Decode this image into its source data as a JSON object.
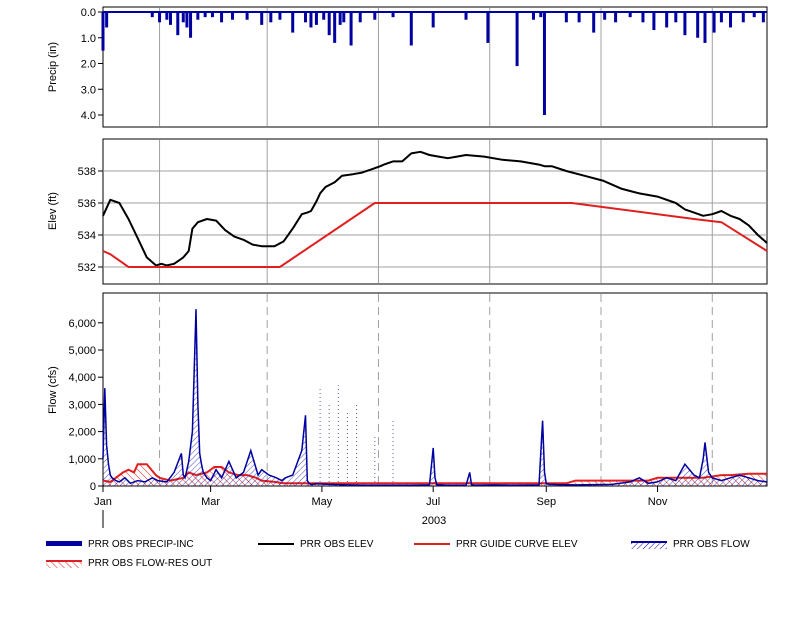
{
  "year_label": "2003",
  "x_months": [
    "Jan",
    "Mar",
    "May",
    "Jul",
    "Sep",
    "Nov"
  ],
  "colors": {
    "precip": "#0000a0",
    "elev": "#000000",
    "guide": "#e02020",
    "flow": "#0000a0",
    "resout": "#e02020",
    "grid": "#a0a0a0"
  },
  "legend": [
    {
      "label": "PRR OBS PRECIP-INC",
      "style": "thick-bar",
      "color": "#0000a0"
    },
    {
      "label": "PRR OBS ELEV",
      "style": "line",
      "color": "#000000"
    },
    {
      "label": "PRR GUIDE CURVE ELEV",
      "style": "line",
      "color": "#e02020"
    },
    {
      "label": "PRR OBS FLOW",
      "style": "hatch-line",
      "color": "#0000a0"
    },
    {
      "label": "PRR OBS FLOW-RES OUT",
      "style": "hatch-line",
      "color": "#e02020"
    }
  ],
  "chart_data": [
    {
      "type": "bar",
      "ylabel": "Precip (in)",
      "ylim": [
        0,
        4.4
      ],
      "y_inverted": true,
      "yticks": [
        "0.0",
        "1.0",
        "2.0",
        "3.0",
        "4.0"
      ],
      "ytick_values": [
        0,
        1,
        2,
        3,
        4
      ],
      "x_unit": "day of year 2003",
      "xlim": [
        1,
        365
      ],
      "series": [
        {
          "name": "PRR OBS PRECIP-INC",
          "x": [
            1,
            3,
            28,
            32,
            36,
            38,
            42,
            45,
            47,
            49,
            53,
            57,
            61,
            66,
            72,
            80,
            88,
            93,
            98,
            105,
            112,
            115,
            118,
            122,
            125,
            128,
            131,
            133,
            137,
            142,
            150,
            160,
            170,
            182,
            200,
            212,
            228,
            237,
            241,
            243,
            255,
            262,
            270,
            276,
            282,
            290,
            297,
            303,
            310,
            315,
            320,
            327,
            331,
            336,
            340,
            345,
            352,
            358,
            363
          ],
          "values": [
            1.5,
            0.6,
            0.2,
            0.4,
            0.3,
            0.5,
            0.9,
            0.4,
            0.6,
            1.0,
            0.3,
            0.2,
            0.2,
            0.4,
            0.3,
            0.3,
            0.5,
            0.4,
            0.3,
            0.8,
            0.4,
            0.6,
            0.5,
            0.3,
            0.9,
            1.2,
            0.5,
            0.4,
            1.3,
            0.4,
            0.3,
            0.2,
            1.3,
            0.6,
            0.3,
            1.2,
            2.1,
            0.3,
            0.2,
            4.0,
            0.4,
            0.4,
            0.8,
            0.3,
            0.4,
            0.2,
            0.4,
            0.7,
            0.6,
            0.4,
            0.9,
            1.0,
            1.2,
            0.8,
            0.4,
            0.6,
            0.4,
            0.2,
            0.4
          ]
        }
      ]
    },
    {
      "type": "line",
      "ylabel": "Elev (ft)",
      "ylim": [
        531.0,
        539.5
      ],
      "yticks": [
        "532",
        "534",
        "536",
        "538"
      ],
      "ytick_values": [
        532,
        534,
        536,
        538
      ],
      "x_unit": "day of year 2003",
      "xlim": [
        1,
        365
      ],
      "series": [
        {
          "name": "PRR OBS ELEV",
          "x": [
            1,
            5,
            10,
            15,
            20,
            25,
            30,
            33,
            36,
            40,
            45,
            48,
            50,
            53,
            58,
            63,
            68,
            73,
            78,
            83,
            88,
            95,
            100,
            105,
            110,
            113,
            115,
            118,
            120,
            123,
            128,
            132,
            138,
            143,
            148,
            153,
            155,
            160,
            165,
            170,
            175,
            180,
            185,
            190,
            195,
            200,
            210,
            220,
            230,
            240,
            243,
            247,
            255,
            265,
            275,
            285,
            295,
            305,
            315,
            320,
            325,
            330,
            335,
            340,
            345,
            350,
            355,
            360,
            365
          ],
          "values": [
            535.2,
            536.2,
            536.0,
            535.0,
            533.8,
            532.6,
            532.1,
            532.2,
            532.1,
            532.2,
            532.6,
            533.0,
            534.4,
            534.8,
            535.0,
            534.9,
            534.3,
            533.9,
            533.7,
            533.4,
            533.3,
            533.3,
            533.6,
            534.4,
            535.3,
            535.4,
            535.5,
            536.1,
            536.6,
            537.0,
            537.3,
            537.7,
            537.8,
            537.9,
            538.1,
            538.3,
            538.4,
            538.6,
            538.6,
            539.1,
            539.2,
            539.0,
            538.9,
            538.8,
            538.9,
            539.0,
            538.9,
            538.7,
            538.6,
            538.4,
            538.3,
            538.3,
            538.0,
            537.7,
            537.4,
            536.9,
            536.6,
            536.4,
            536.0,
            535.6,
            535.4,
            535.2,
            535.3,
            535.5,
            535.2,
            535.0,
            534.6,
            534.0,
            533.5
          ]
        },
        {
          "name": "PRR GUIDE CURVE ELEV",
          "x": [
            1,
            5,
            10,
            15,
            98,
            150,
            258,
            325,
            340,
            365
          ],
          "values": [
            533.0,
            532.8,
            532.4,
            532.0,
            532.0,
            536.0,
            536.0,
            535.0,
            534.8,
            533.0
          ]
        }
      ]
    },
    {
      "type": "area",
      "ylabel": "Flow (cfs)",
      "ylim": [
        0,
        6900
      ],
      "yticks": [
        "0",
        "1,000",
        "2,000",
        "3,000",
        "4,000",
        "5,000",
        "6,000"
      ],
      "ytick_values": [
        0,
        1000,
        2000,
        3000,
        4000,
        5000,
        6000
      ],
      "x_unit": "day of year 2003",
      "xlim": [
        1,
        365
      ],
      "grid": "vertical dashed at month boundaries",
      "series": [
        {
          "name": "PRR OBS FLOW",
          "x": [
            1,
            2,
            3,
            4,
            5,
            6,
            8,
            10,
            13,
            16,
            20,
            24,
            28,
            31,
            36,
            40,
            44,
            45,
            46,
            47,
            48,
            50,
            52,
            53,
            54,
            55,
            56,
            58,
            60,
            63,
            66,
            70,
            74,
            78,
            82,
            86,
            88,
            92,
            96,
            99,
            101,
            105,
            110,
            112,
            113,
            114,
            115,
            118,
            125,
            135,
            145,
            160,
            170,
            180,
            182,
            183,
            184,
            190,
            200,
            202,
            203,
            205,
            215,
            225,
            240,
            242,
            243,
            244,
            246,
            250,
            260,
            270,
            280,
            290,
            295,
            300,
            305,
            310,
            315,
            320,
            325,
            328,
            330,
            331,
            333,
            335,
            340,
            345,
            350,
            355,
            360,
            365
          ],
          "values": [
            1000,
            3600,
            1500,
            800,
            400,
            300,
            200,
            150,
            300,
            100,
            200,
            150,
            300,
            200,
            150,
            500,
            1200,
            400,
            300,
            600,
            900,
            2000,
            6500,
            3000,
            1200,
            800,
            500,
            300,
            200,
            600,
            300,
            900,
            300,
            500,
            1300,
            400,
            600,
            400,
            300,
            200,
            300,
            400,
            1300,
            2600,
            200,
            100,
            50,
            80,
            60,
            40,
            30,
            30,
            30,
            40,
            1400,
            300,
            50,
            30,
            30,
            500,
            50,
            30,
            40,
            30,
            40,
            2400,
            500,
            80,
            60,
            50,
            40,
            50,
            60,
            150,
            300,
            100,
            150,
            300,
            200,
            800,
            400,
            300,
            1000,
            1600,
            500,
            300,
            200,
            300,
            400,
            300,
            200,
            150
          ]
        },
        {
          "name": "PRR OBS FLOW-RES OUT",
          "x": [
            1,
            5,
            8,
            12,
            15,
            18,
            20,
            25,
            30,
            32,
            38,
            45,
            48,
            52,
            58,
            62,
            66,
            70,
            75,
            80,
            85,
            88,
            95,
            100,
            110,
            130,
            150,
            180,
            200,
            220,
            240,
            255,
            260,
            270,
            280,
            290,
            300,
            305,
            320,
            330,
            340,
            345,
            355,
            365
          ],
          "values": [
            200,
            150,
            300,
            500,
            600,
            500,
            800,
            800,
            400,
            300,
            200,
            300,
            500,
            400,
            500,
            700,
            700,
            500,
            400,
            400,
            300,
            200,
            150,
            100,
            100,
            100,
            100,
            100,
            100,
            100,
            100,
            100,
            200,
            200,
            200,
            200,
            200,
            300,
            300,
            300,
            400,
            400,
            450,
            450
          ]
        },
        {
          "name": "dashed observed flow spikes (unlabeled)",
          "x": [
            120,
            125,
            130,
            135,
            140,
            150,
            160
          ],
          "values": [
            3600,
            3000,
            3700,
            2800,
            3000,
            1800,
            2400
          ]
        }
      ]
    }
  ]
}
